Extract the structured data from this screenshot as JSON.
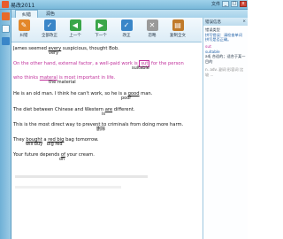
{
  "window": {
    "title": "易改2011",
    "menu_label": "文件",
    "buttons": [
      "_",
      "□",
      "x"
    ]
  },
  "tabs": [
    {
      "label": "纠错",
      "active": true
    },
    {
      "label": "润色",
      "active": false
    }
  ],
  "toolbar": [
    {
      "label": "纠错",
      "color": "#e3872a",
      "glyph": "✎"
    },
    {
      "label": "全部改正",
      "color": "#3a86c8",
      "glyph": "✓"
    },
    {
      "label": "上一个",
      "color": "#3aa64a",
      "glyph": "◀"
    },
    {
      "label": "下一个",
      "color": "#3aa64a",
      "glyph": "▶"
    },
    {
      "label": "改正",
      "color": "#3a86c8",
      "glyph": "✓"
    },
    {
      "label": "忽略",
      "color": "#9a9a9a",
      "glyph": "✕"
    },
    {
      "label": "复制全文",
      "color": "#c07a2a",
      "glyph": "▤"
    }
  ],
  "sentences": [
    {
      "text_before": "James seemed ",
      "underlined": "every",
      "text_after": " suspicious, thought Bob.",
      "note": "very"
    },
    {
      "text_before": "On the other hand, external factor, a well-paid work is ",
      "boxed": "sut",
      "text_after": " for the person",
      "note": "suitable"
    },
    {
      "text_before": "who thinks ",
      "underlined": "materal",
      "text_after": " is most important in life.",
      "note": "the material"
    },
    {
      "text_before": "He is an old man. I think he can't work, so he is a ",
      "underlined": "good",
      "text_after": " man.",
      "note": "poor"
    },
    {
      "text_before": "The diet between Chinese and Western ",
      "underlined": "are",
      "text_after": " different.",
      "note": "is"
    },
    {
      "text_before": "This is the most direct way to prevent to criminals from doing more harm.",
      "underlined": "",
      "text_after": "",
      "note": "删除"
    },
    {
      "text_before": "They ",
      "underlined": "bought",
      "mid": " a ",
      "underlined2": "red big",
      "text_after": " bag tomorrow.",
      "note": "will buy",
      "note2": "big red"
    },
    {
      "text_before": "Your future depends ",
      "underlined": "of",
      "text_after": " your cream.",
      "note": "on"
    }
  ],
  "right_panel": {
    "header": "错误信息",
    "error_type_label": "错误类型",
    "error_desc": "拼写错误：请检查单词拼写是否正确。",
    "word": "sut",
    "suggestion_label": "suitable",
    "detail": "adj 合适的；适合于某一目的 ",
    "extra": "n. adv. 副词 形容词 比较 ..."
  }
}
